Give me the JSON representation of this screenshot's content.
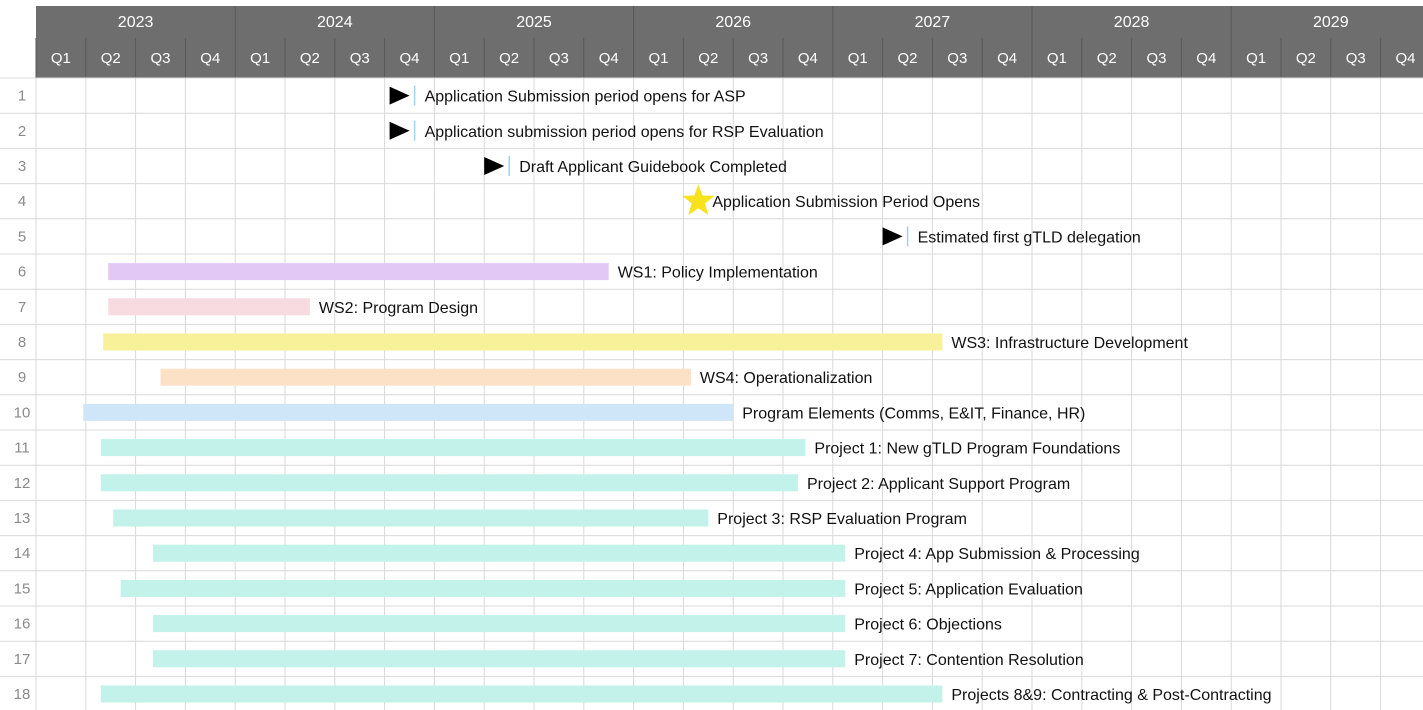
{
  "chart_data": {
    "type": "gantt",
    "colors": {
      "header_bg": "#6e6e6e",
      "grid": "#d9d9d9",
      "milestone": "#000000",
      "milestone_tick": "#9fd3f2",
      "star": "#f7e21d"
    },
    "years": [
      "2023",
      "2024",
      "2025",
      "2026",
      "2027",
      "2028",
      "2029"
    ],
    "quarters": [
      "Q1",
      "Q2",
      "Q3",
      "Q4"
    ],
    "start_quarter_index": 0,
    "total_quarters": 28,
    "rows": [
      {
        "num": "1",
        "type": "milestone",
        "marker": "arrow",
        "at": 7.1,
        "label": "Application Submission period opens for ASP"
      },
      {
        "num": "2",
        "type": "milestone",
        "marker": "arrow",
        "at": 7.1,
        "label": "Application submission period opens for RSP Evaluation"
      },
      {
        "num": "3",
        "type": "milestone",
        "marker": "arrow",
        "at": 9.0,
        "label": "Draft Applicant Guidebook Completed"
      },
      {
        "num": "4",
        "type": "milestone",
        "marker": "star",
        "at": 13.3,
        "label": "Application Submission Period Opens"
      },
      {
        "num": "5",
        "type": "milestone",
        "marker": "arrow",
        "at": 17.0,
        "label": "Estimated first gTLD delegation"
      },
      {
        "num": "6",
        "type": "bar",
        "start": 1.45,
        "end": 11.5,
        "color": "#e2c8f5",
        "label": "WS1: Policy Implementation"
      },
      {
        "num": "7",
        "type": "bar",
        "start": 1.45,
        "end": 5.5,
        "color": "#f8dbe1",
        "label": "WS2: Program Design"
      },
      {
        "num": "8",
        "type": "bar",
        "start": 1.35,
        "end": 18.2,
        "color": "#f8f199",
        "label": "WS3: Infrastructure Development"
      },
      {
        "num": "9",
        "type": "bar",
        "start": 2.5,
        "end": 13.15,
        "color": "#fce1c6",
        "label": "WS4: Operationalization"
      },
      {
        "num": "10",
        "type": "bar",
        "start": 0.95,
        "end": 14.0,
        "color": "#cfe6f8",
        "label": "Program Elements (Comms, E&IT, Finance, HR)"
      },
      {
        "num": "11",
        "type": "bar",
        "start": 1.3,
        "end": 15.45,
        "color": "#c2f2ea",
        "label": "Project 1: New gTLD Program Foundations"
      },
      {
        "num": "12",
        "type": "bar",
        "start": 1.3,
        "end": 15.3,
        "color": "#c2f2ea",
        "label": "Project 2: Applicant Support Program"
      },
      {
        "num": "13",
        "type": "bar",
        "start": 1.55,
        "end": 13.5,
        "color": "#c2f2ea",
        "label": "Project 3: RSP Evaluation Program"
      },
      {
        "num": "14",
        "type": "bar",
        "start": 2.35,
        "end": 16.25,
        "color": "#c2f2ea",
        "label": "Project 4: App Submission & Processing"
      },
      {
        "num": "15",
        "type": "bar",
        "start": 1.7,
        "end": 16.25,
        "color": "#c2f2ea",
        "label": "Project 5: Application Evaluation"
      },
      {
        "num": "16",
        "type": "bar",
        "start": 2.35,
        "end": 16.25,
        "color": "#c2f2ea",
        "label": "Project 6: Objections"
      },
      {
        "num": "17",
        "type": "bar",
        "start": 2.35,
        "end": 16.25,
        "color": "#c2f2ea",
        "label": "Project 7: Contention Resolution"
      },
      {
        "num": "18",
        "type": "bar",
        "start": 1.3,
        "end": 18.2,
        "color": "#c2f2ea",
        "label": "Projects 8&9: Contracting & Post-Contracting"
      }
    ]
  }
}
